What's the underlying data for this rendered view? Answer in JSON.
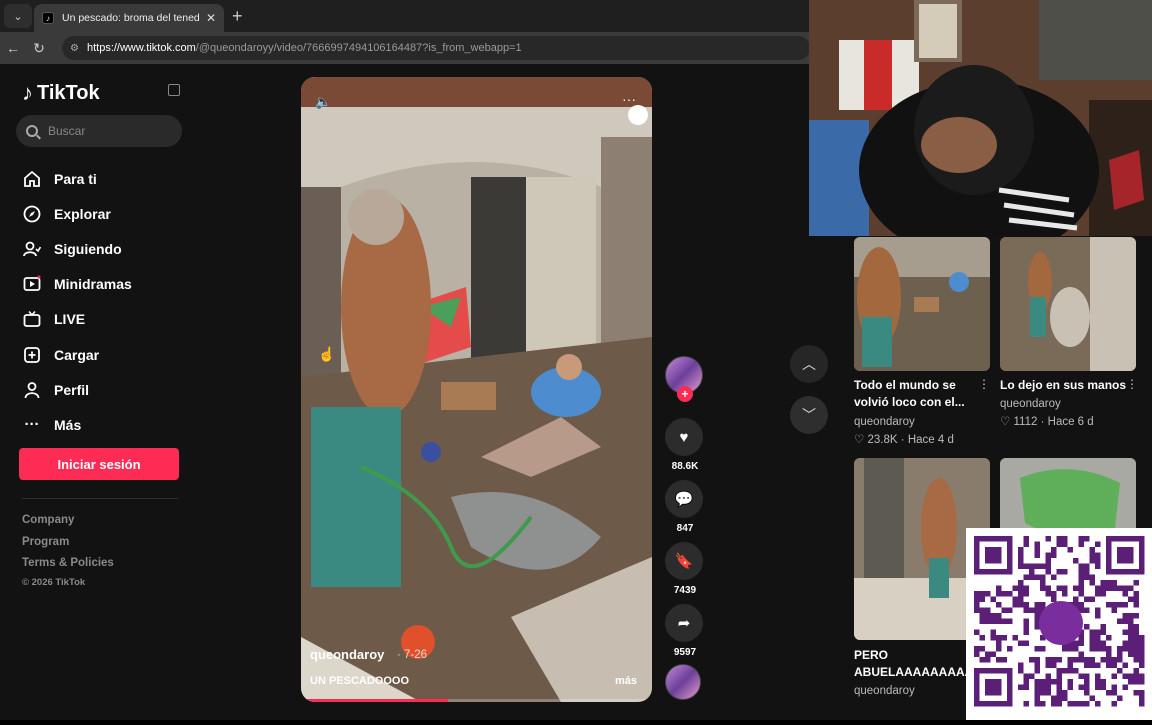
{
  "browser": {
    "tab_title": "Un pescado: broma del tenedor y",
    "tab_close": "✕",
    "new_tab": "+",
    "url_host": "https://www.tiktok.com",
    "url_path": "/@queondaroyy/video/7666997494106164487?is_from_webapp=1"
  },
  "sidebar": {
    "logo_text": "TikTok",
    "search_placeholder": "Buscar",
    "nav": [
      {
        "label": "Para ti",
        "icon": "home-icon"
      },
      {
        "label": "Explorar",
        "icon": "compass-icon"
      },
      {
        "label": "Siguiendo",
        "icon": "following-icon"
      },
      {
        "label": "Minidramas",
        "icon": "film-icon"
      },
      {
        "label": "LIVE",
        "icon": "live-icon"
      },
      {
        "label": "Cargar",
        "icon": "upload-icon"
      },
      {
        "label": "Perfil",
        "icon": "profile-icon"
      },
      {
        "label": "Más",
        "icon": "more-icon"
      }
    ],
    "login_label": "Iniciar sesión",
    "footer_links": [
      "Company",
      "Program",
      "Terms & Policies"
    ],
    "copyright": "© 2026 TikTok"
  },
  "video": {
    "author": "queondaroy",
    "date": "· 7-26",
    "caption": "UN PESCADOOOO",
    "more_label": "más",
    "progress": 0.42
  },
  "actions": {
    "likes": "88.6K",
    "comments": "847",
    "saves": "7439",
    "shares": "9597"
  },
  "recommended": [
    {
      "title": "Todo el mundo se volvió loco con el...",
      "author": "queondaroy",
      "likes": "23.8K",
      "age": "Hace 4 d"
    },
    {
      "title": "Lo dejo en sus manos",
      "author": "queondaroy",
      "likes": "1112",
      "age": "Hace 6 d"
    },
    {
      "title": "PERO ABUELAAAAAAAAA",
      "author": "queondaroy",
      "likes": "",
      "age": ""
    },
    {
      "title": "",
      "author": "",
      "likes": "",
      "age": ""
    }
  ],
  "colors": {
    "accent": "#fe2c55",
    "background": "#121212"
  }
}
